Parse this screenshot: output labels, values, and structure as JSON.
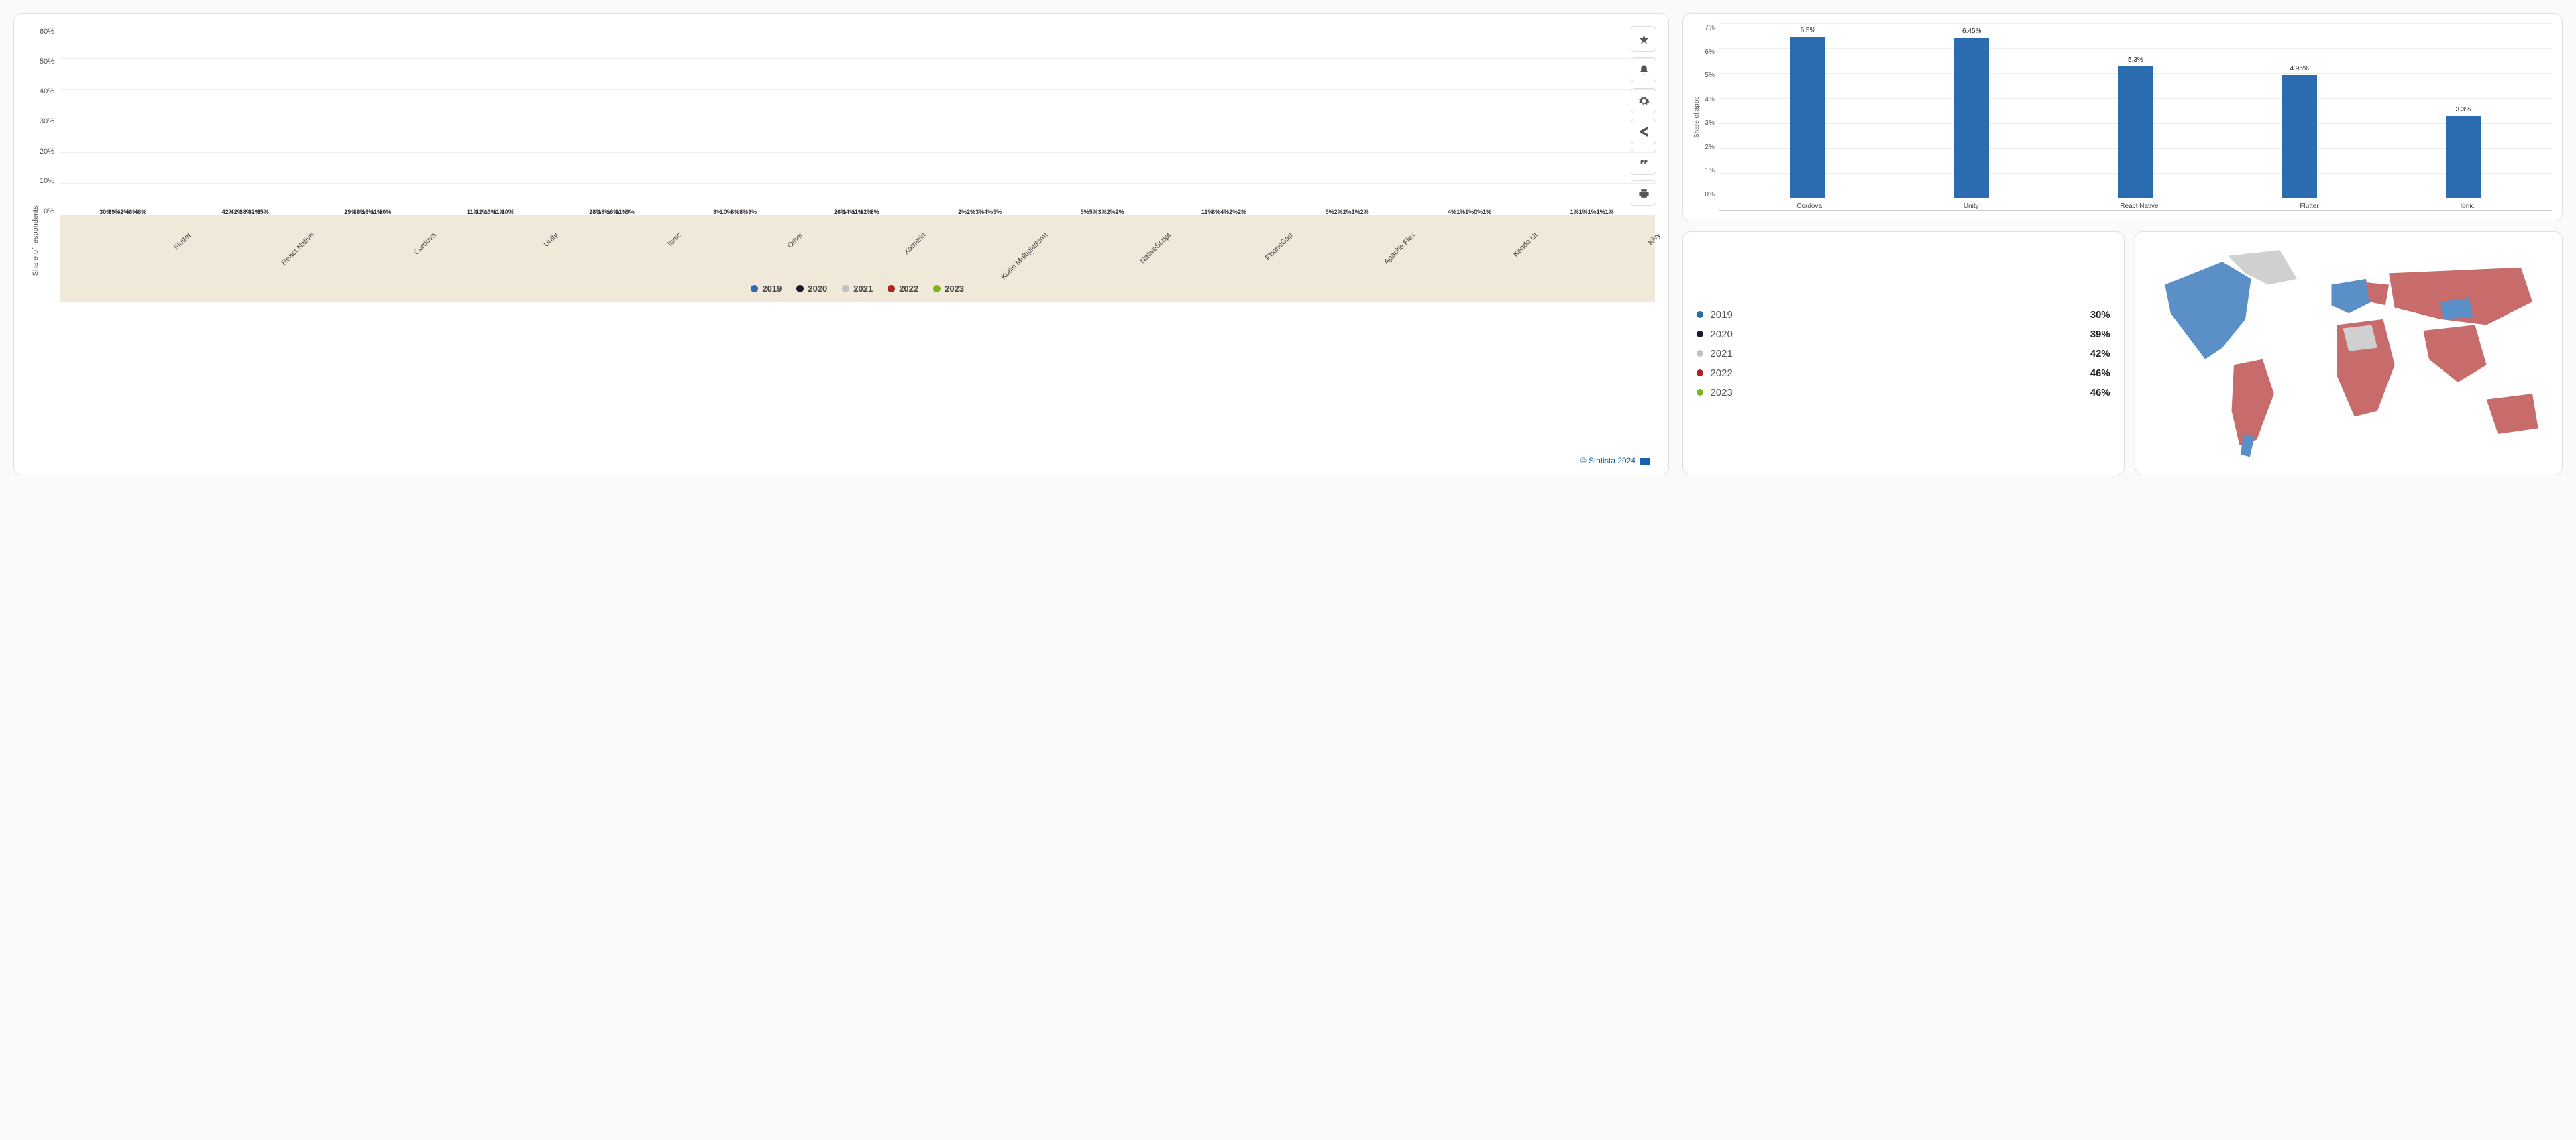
{
  "chart_data": [
    {
      "type": "bar",
      "title": "",
      "ylabel": "Share of respondents",
      "xlabel": "",
      "ylim": [
        0,
        60
      ],
      "yticks": [
        "0%",
        "10%",
        "20%",
        "30%",
        "40%",
        "50%",
        "60%"
      ],
      "categories": [
        "Flutter",
        "React Native",
        "Cordova",
        "Unity",
        "Ionic",
        "Other",
        "Xamarin",
        "Kotlin Multiplatform",
        "NativeScript",
        "PhoneGap",
        "Apache Flex",
        "Kendo UI",
        "Kivy"
      ],
      "series": [
        {
          "name": "2019",
          "color": "#2b6cb0",
          "values": [
            30,
            42,
            29,
            11,
            28,
            8,
            26,
            2,
            5,
            11,
            5,
            4,
            1
          ]
        },
        {
          "name": "2020",
          "color": "#1a1a2c",
          "values": [
            39,
            42,
            18,
            12,
            18,
            10,
            14,
            2,
            5,
            6,
            2,
            1,
            1
          ]
        },
        {
          "name": "2021",
          "color": "#c0c0c0",
          "values": [
            42,
            38,
            16,
            13,
            16,
            8,
            11,
            3,
            3,
            4,
            2,
            1,
            1
          ]
        },
        {
          "name": "2022",
          "color": "#b22222",
          "values": [
            46,
            32,
            11,
            11,
            11,
            8,
            12,
            4,
            2,
            2,
            1,
            0,
            1
          ]
        },
        {
          "name": "2023",
          "color": "#7cb518",
          "values": [
            46,
            35,
            10,
            10,
            9,
            9,
            8,
            5,
            2,
            2,
            2,
            1,
            1
          ]
        }
      ],
      "attribution": "© Statista 2024"
    },
    {
      "type": "bar",
      "ylabel": "Share of apps",
      "ylim": [
        0,
        7
      ],
      "yticks": [
        "0%",
        "1%",
        "2%",
        "3%",
        "4%",
        "5%",
        "6%",
        "7%"
      ],
      "categories": [
        "Cordova",
        "Unity",
        "React Native",
        "Flutter",
        "Ionic"
      ],
      "values": [
        6.5,
        6.45,
        5.3,
        4.95,
        3.3
      ],
      "color": "#2b6cb0"
    }
  ],
  "legend_detail": {
    "rows": [
      {
        "year": "2019",
        "value": "30%",
        "color": "#2b6cb0"
      },
      {
        "year": "2020",
        "value": "39%",
        "color": "#1a1a2c"
      },
      {
        "year": "2021",
        "value": "42%",
        "color": "#c0c0c0"
      },
      {
        "year": "2022",
        "value": "46%",
        "color": "#b22222"
      },
      {
        "year": "2023",
        "value": "46%",
        "color": "#7cb518"
      }
    ]
  },
  "toolbar": {
    "favorite": "star-icon",
    "notify": "bell-icon",
    "settings": "gear-icon",
    "share": "share-icon",
    "cite": "quote-icon",
    "print": "print-icon"
  },
  "map": {
    "colors": {
      "primary": "#5a8fc7",
      "secondary": "#c76b6b",
      "neutral": "#d0d0d0"
    }
  }
}
